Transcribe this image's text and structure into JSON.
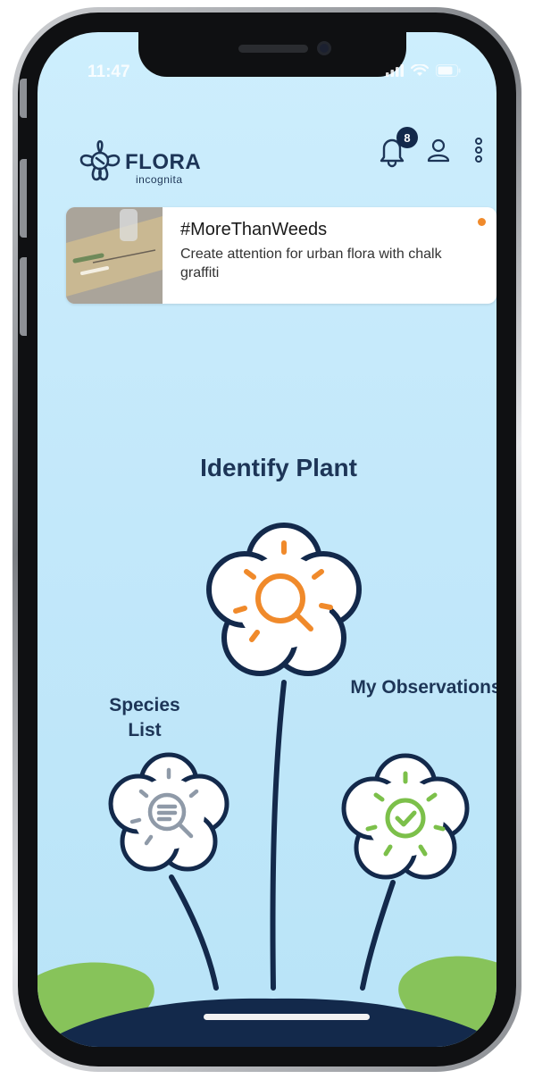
{
  "status_bar": {
    "time": "11:47"
  },
  "header": {
    "logo": {
      "word": "FLORA",
      "sub": "incognita"
    },
    "notifications": {
      "count": "8"
    }
  },
  "news": {
    "title": "#MoreThanWeeds",
    "description": "Create attention for urban flora with chalk graffiti"
  },
  "actions": {
    "identify": "Identify Plant",
    "species": "Species List",
    "observations": "My Observations"
  },
  "colors": {
    "navy": "#1d3557",
    "orange": "#f08a2b",
    "grey": "#8f9aa8",
    "green": "#7cc04a",
    "grass": "#87c35a",
    "sky": "#c6eafb"
  },
  "icons": {
    "bell": "bell-icon",
    "profile": "profile-icon",
    "more": "more-vertical-icon",
    "identify": "magnifier-icon",
    "species": "list-magnifier-icon",
    "observations": "check-circle-icon"
  }
}
